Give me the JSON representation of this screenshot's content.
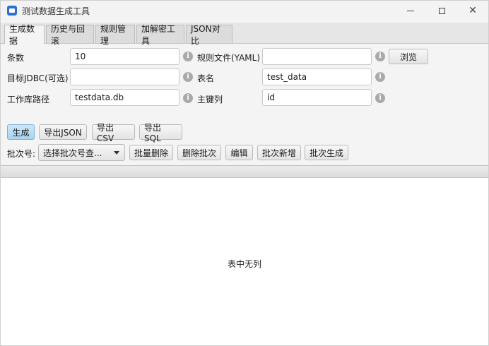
{
  "window": {
    "title": "测试数据生成工具"
  },
  "tabs": [
    {
      "label": "生成数据",
      "active": true
    },
    {
      "label": "历史与回滚",
      "active": false
    },
    {
      "label": "规则管理",
      "active": false
    },
    {
      "label": "加解密工具",
      "active": false
    },
    {
      "label": "JSON对比",
      "active": false
    }
  ],
  "form": {
    "count": {
      "label": "条数",
      "value": "10"
    },
    "rule_file": {
      "label": "规则文件(YAML)",
      "value": ""
    },
    "target_jdbc": {
      "label": "目标JDBC(可选)",
      "value": ""
    },
    "table_name": {
      "label": "表名",
      "value": "test_data"
    },
    "db_path": {
      "label": "工作库路径",
      "value": "testdata.db"
    },
    "primary_key": {
      "label": "主键列",
      "value": "id"
    },
    "browse_button": "浏览"
  },
  "actions": {
    "generate": "生成",
    "export_json": "导出JSON",
    "export_csv": "导出CSV",
    "export_sql": "导出SQL"
  },
  "batch": {
    "label": "批次号:",
    "select_value": "选择批次号查...",
    "bulk_delete": "批量删除",
    "delete_batch": "删除批次",
    "edit": "编辑",
    "batch_add": "批次新增",
    "batch_generate": "批次生成"
  },
  "table": {
    "placeholder": "表中无列"
  },
  "colors": {
    "primary_button": "#a9d3f0",
    "info_icon": "#a9a9a9",
    "app_icon": "#2a6fd1"
  }
}
